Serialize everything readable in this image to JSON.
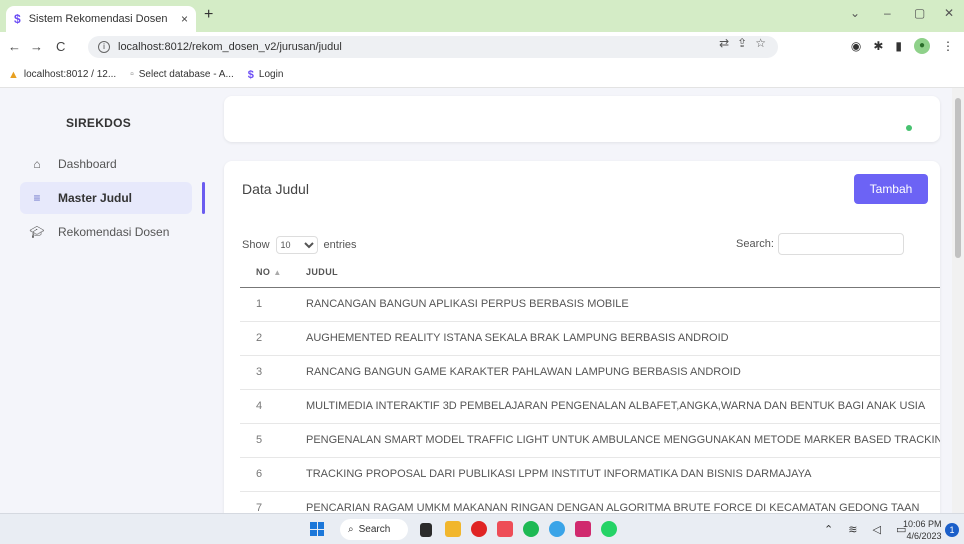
{
  "browser": {
    "tab_title": "Sistem Rekomendasi Dosen",
    "tab_close": "×",
    "new_tab": "+",
    "url": "localhost:8012/rekom_dosen_v2/jurusan/judul",
    "window_controls": {
      "minimize": "–",
      "maximize": "▢",
      "close": "✕",
      "chevron": "⌄"
    },
    "bookmarks": [
      {
        "label": "localhost:8012 / 12..."
      },
      {
        "label": "Select database - A..."
      },
      {
        "label": "Login"
      }
    ]
  },
  "sidebar": {
    "brand": "SIREKDOS",
    "items": [
      {
        "label": "Dashboard",
        "icon": "home-icon",
        "active": false
      },
      {
        "label": "Master Judul",
        "icon": "list-icon",
        "active": true
      },
      {
        "label": "Rekomendasi Dosen",
        "icon": "graduation-cap-icon",
        "active": false
      }
    ]
  },
  "card": {
    "title": "Data Judul",
    "add_button": "Tambah",
    "show_label": "Show",
    "entries_value": "10",
    "entries_label": "entries",
    "search_label": "Search:",
    "search_value": ""
  },
  "table": {
    "headers": {
      "no": "NO",
      "judul": "JUDUL"
    },
    "rows": [
      {
        "no": "1",
        "judul": "RANCANGAN BANGUN APLIKASI PERPUS BERBASIS MOBILE"
      },
      {
        "no": "2",
        "judul": "AUGHEMENTED REALITY ISTANA SEKALA BRAK LAMPUNG BERBASIS ANDROID"
      },
      {
        "no": "3",
        "judul": "RANCANG BANGUN GAME KARAKTER PAHLAWAN LAMPUNG BERBASIS ANDROID"
      },
      {
        "no": "4",
        "judul": "MULTIMEDIA INTERAKTIF 3D PEMBELAJARAN PENGENALAN ALBAFET,ANGKA,WARNA DAN BENTUK BAGI ANAK USIA"
      },
      {
        "no": "5",
        "judul": "PENGENALAN SMART MODEL TRAFFIC LIGHT UNTUK AMBULANCE MENGGUNAKAN METODE MARKER BASED TRACKING"
      },
      {
        "no": "6",
        "judul": "TRACKING PROPOSAL DARI PUBLIKASI LPPM INSTITUT INFORMATIKA DAN BISNIS DARMAJAYA"
      },
      {
        "no": "7",
        "judul": "PENCARIAN RAGAM UMKM MAKANAN RINGAN DENGAN ALGORITMA BRUTE FORCE DI KECAMATAN GEDONG TAAN"
      }
    ]
  },
  "taskbar": {
    "search_label": "Search",
    "time": "10:06 PM",
    "date": "4/6/2023",
    "notification_count": "1"
  },
  "colors": {
    "accent": "#6c63f5",
    "tab_strip": "#d4ecc6",
    "status_dot": "#47c270"
  }
}
